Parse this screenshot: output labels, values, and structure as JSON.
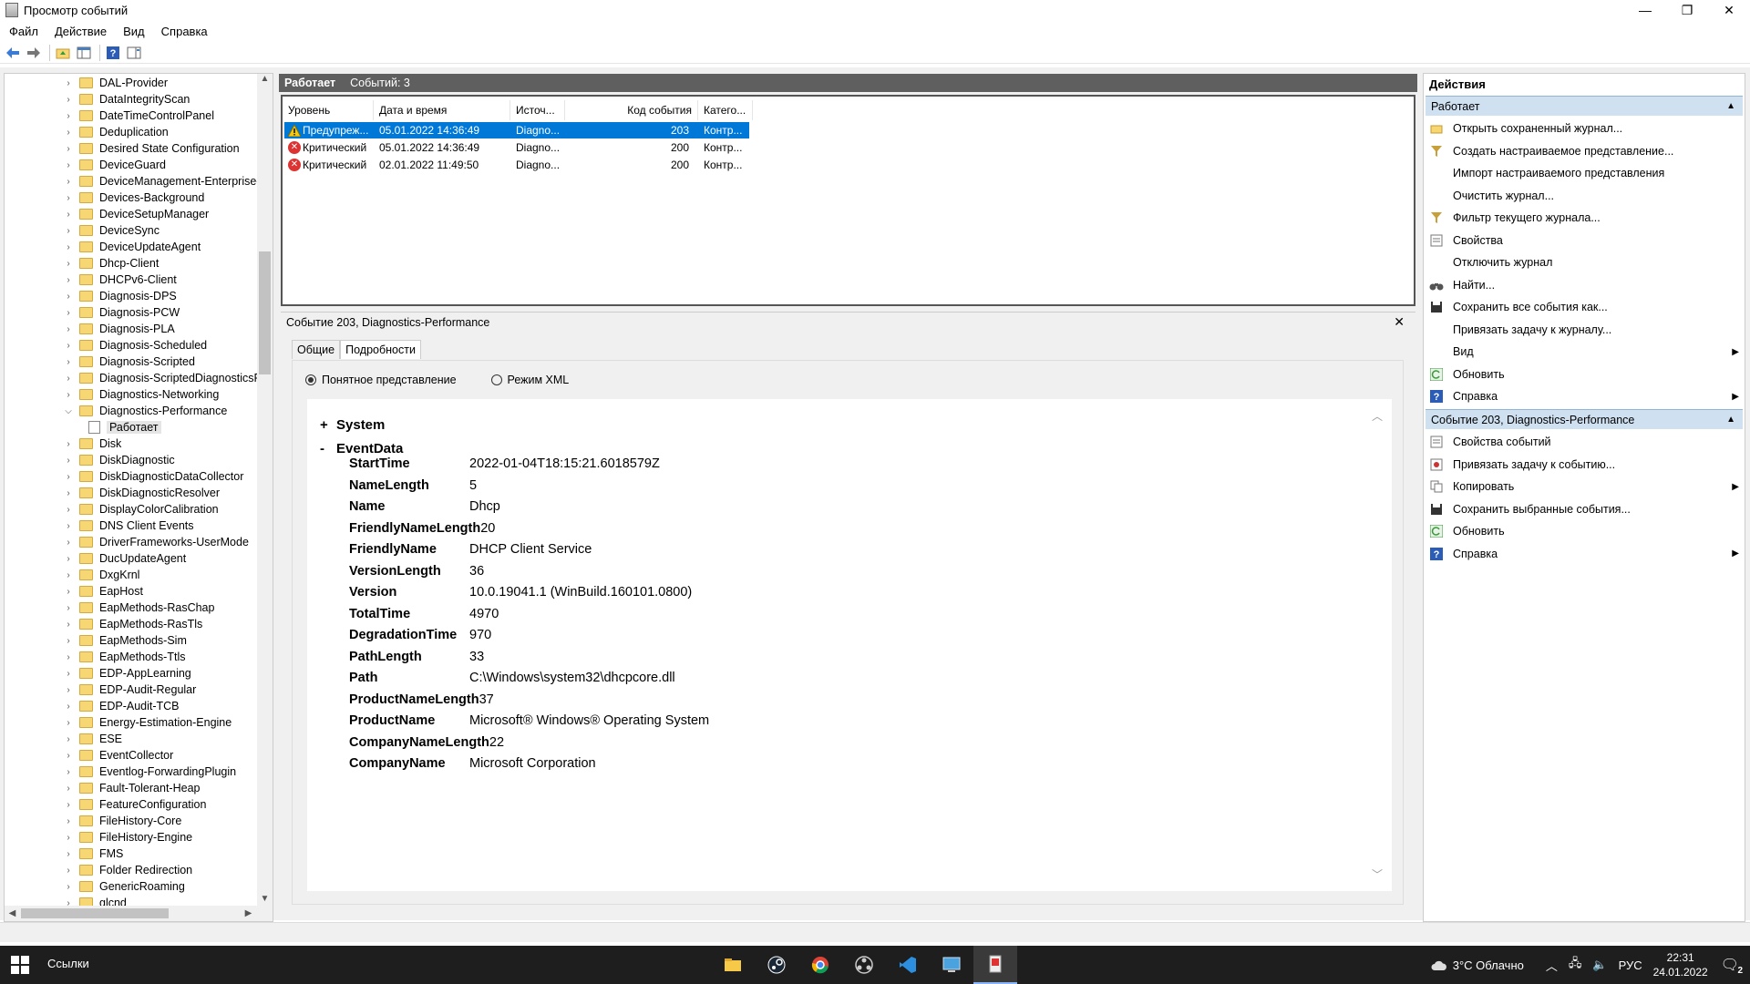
{
  "window": {
    "title": "Просмотр событий",
    "minimize": "—",
    "maximize": "❐",
    "close": "✕"
  },
  "menu": [
    "Файл",
    "Действие",
    "Вид",
    "Справка"
  ],
  "toolbar": {
    "back_icon": "arrow-left-icon",
    "forward_icon": "arrow-right-icon",
    "help_glyph": "?"
  },
  "tree": {
    "items": [
      {
        "label": "DAL-Provider"
      },
      {
        "label": "DataIntegrityScan"
      },
      {
        "label": "DateTimeControlPanel"
      },
      {
        "label": "Deduplication"
      },
      {
        "label": "Desired State Configuration"
      },
      {
        "label": "DeviceGuard"
      },
      {
        "label": "DeviceManagement-Enterprise-D"
      },
      {
        "label": "Devices-Background"
      },
      {
        "label": "DeviceSetupManager"
      },
      {
        "label": "DeviceSync"
      },
      {
        "label": "DeviceUpdateAgent"
      },
      {
        "label": "Dhcp-Client"
      },
      {
        "label": "DHCPv6-Client"
      },
      {
        "label": "Diagnosis-DPS"
      },
      {
        "label": "Diagnosis-PCW"
      },
      {
        "label": "Diagnosis-PLA"
      },
      {
        "label": "Diagnosis-Scheduled"
      },
      {
        "label": "Diagnosis-Scripted"
      },
      {
        "label": "Diagnosis-ScriptedDiagnosticsPro"
      },
      {
        "label": "Diagnostics-Networking"
      },
      {
        "label": "Diagnostics-Performance",
        "expanded": true
      },
      {
        "label": "Работает",
        "child": true,
        "selected": true
      },
      {
        "label": "Disk"
      },
      {
        "label": "DiskDiagnostic"
      },
      {
        "label": "DiskDiagnosticDataCollector"
      },
      {
        "label": "DiskDiagnosticResolver"
      },
      {
        "label": "DisplayColorCalibration"
      },
      {
        "label": "DNS Client Events"
      },
      {
        "label": "DriverFrameworks-UserMode"
      },
      {
        "label": "DucUpdateAgent"
      },
      {
        "label": "DxgKrnl"
      },
      {
        "label": "EapHost"
      },
      {
        "label": "EapMethods-RasChap"
      },
      {
        "label": "EapMethods-RasTls"
      },
      {
        "label": "EapMethods-Sim"
      },
      {
        "label": "EapMethods-Ttls"
      },
      {
        "label": "EDP-AppLearning"
      },
      {
        "label": "EDP-Audit-Regular"
      },
      {
        "label": "EDP-Audit-TCB"
      },
      {
        "label": "Energy-Estimation-Engine"
      },
      {
        "label": "ESE"
      },
      {
        "label": "EventCollector"
      },
      {
        "label": "Eventlog-ForwardingPlugin"
      },
      {
        "label": "Fault-Tolerant-Heap"
      },
      {
        "label": "FeatureConfiguration"
      },
      {
        "label": "FileHistory-Core"
      },
      {
        "label": "FileHistory-Engine"
      },
      {
        "label": "FMS"
      },
      {
        "label": "Folder Redirection"
      },
      {
        "label": "GenericRoaming"
      },
      {
        "label": "glcnd"
      }
    ]
  },
  "center": {
    "log_name": "Работает",
    "event_count": "Событий: 3",
    "columns": [
      "Уровень",
      "Дата и время",
      "Источ...",
      "Код события",
      "Катего..."
    ],
    "rows": [
      {
        "level": "Предупреж...",
        "type": "warn",
        "date": "05.01.2022 14:36:49",
        "source": "Diagno...",
        "code": "203",
        "cat": "Контр...",
        "selected": true
      },
      {
        "level": "Критический",
        "type": "crit",
        "date": "05.01.2022 14:36:49",
        "source": "Diagno...",
        "code": "200",
        "cat": "Контр..."
      },
      {
        "level": "Критический",
        "type": "crit",
        "date": "02.01.2022 11:49:50",
        "source": "Diagno...",
        "code": "200",
        "cat": "Контр..."
      }
    ]
  },
  "detail": {
    "title": "Событие 203, Diagnostics-Performance",
    "close": "✕",
    "tabs": [
      "Общие",
      "Подробности"
    ],
    "radio_friendly": "Понятное представление",
    "radio_xml": "Режим XML",
    "sections": [
      {
        "sign": "+",
        "name": "System"
      },
      {
        "sign": "-",
        "name": "EventData"
      }
    ],
    "fields": [
      {
        "k": "StartTime",
        "v": "2022-01-04T18:15:21.6018579Z"
      },
      {
        "k": "NameLength",
        "v": "5"
      },
      {
        "k": "Name",
        "v": "Dhcp"
      },
      {
        "k": "FriendlyNameLength",
        "v": "20"
      },
      {
        "k": "FriendlyName",
        "v": "DHCP Client Service"
      },
      {
        "k": "VersionLength",
        "v": "36"
      },
      {
        "k": "Version",
        "v": "10.0.19041.1 (WinBuild.160101.0800)"
      },
      {
        "k": "TotalTime",
        "v": "4970"
      },
      {
        "k": "DegradationTime",
        "v": "970"
      },
      {
        "k": "PathLength",
        "v": "33"
      },
      {
        "k": "Path",
        "v": "C:\\Windows\\system32\\dhcpcore.dll"
      },
      {
        "k": "ProductNameLength",
        "v": "37"
      },
      {
        "k": "ProductName",
        "v": "Microsoft® Windows® Operating System"
      },
      {
        "k": "CompanyNameLength",
        "v": "22"
      },
      {
        "k": "CompanyName",
        "v": "Microsoft Corporation"
      }
    ]
  },
  "actions": {
    "header": "Действия",
    "section1": "Работает",
    "items1": [
      {
        "label": "Открыть сохраненный журнал...",
        "icon": "open-log-icon"
      },
      {
        "label": "Создать настраиваемое представление...",
        "icon": "filter-icon"
      },
      {
        "label": "Импорт настраиваемого представления",
        "icon": ""
      },
      {
        "label": "Очистить журнал...",
        "icon": ""
      },
      {
        "label": "Фильтр текущего журнала...",
        "icon": "filter-icon"
      },
      {
        "label": "Свойства",
        "icon": "properties-icon"
      },
      {
        "label": "Отключить журнал",
        "icon": ""
      },
      {
        "label": "Найти...",
        "icon": "binoculars-icon"
      },
      {
        "label": "Сохранить все события как...",
        "icon": "save-icon"
      },
      {
        "label": "Привязать задачу к журналу...",
        "icon": ""
      },
      {
        "label": "Вид",
        "icon": "",
        "submenu": true
      },
      {
        "label": "Обновить",
        "icon": "refresh-icon"
      },
      {
        "label": "Справка",
        "icon": "help-icon",
        "submenu": true
      }
    ],
    "section2": "Событие 203, Diagnostics-Performance",
    "items2": [
      {
        "label": "Свойства событий",
        "icon": "properties-icon"
      },
      {
        "label": "Привязать задачу к событию...",
        "icon": "task-icon"
      },
      {
        "label": "Копировать",
        "icon": "copy-icon",
        "submenu": true
      },
      {
        "label": "Сохранить выбранные события...",
        "icon": "save-icon"
      },
      {
        "label": "Обновить",
        "icon": "refresh-icon"
      },
      {
        "label": "Справка",
        "icon": "help-icon",
        "submenu": true
      }
    ]
  },
  "taskbar": {
    "links": "Ссылки",
    "weather": "3°C Облачно",
    "lang": "РУС",
    "time": "22:31",
    "date": "24.01.2022",
    "notifications": "2"
  }
}
